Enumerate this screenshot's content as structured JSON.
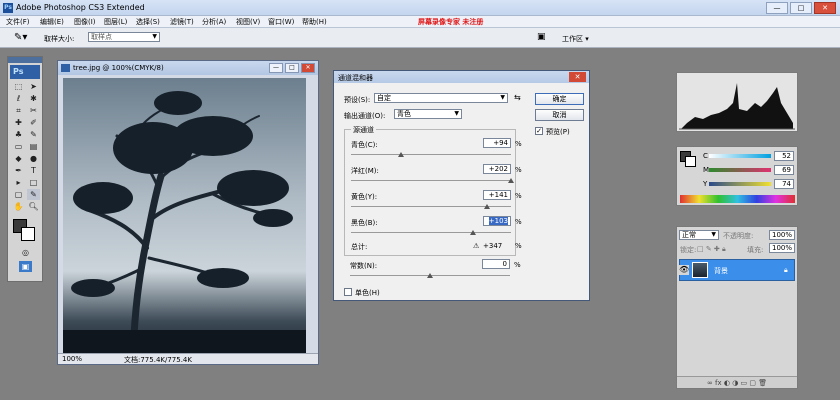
{
  "app": {
    "title": "Adobe Photoshop CS3 Extended",
    "watermark": "屏幕录像专家 未注册",
    "menu": [
      "文件(F)",
      "编辑(E)",
      "图像(I)",
      "图层(L)",
      "选择(S)",
      "滤镜(T)",
      "分析(A)",
      "视图(V)",
      "窗口(W)",
      "帮助(H)"
    ],
    "window_buttons": [
      "—",
      "□",
      "✕"
    ]
  },
  "options_bar": {
    "sample_size_label": "取样大小:",
    "sample_size_value": "取样点",
    "workspace_label": "工作区 ▾"
  },
  "document": {
    "title": "tree.jpg @ 100%(CMYK/8)",
    "zoom": "100%",
    "status": "文档:775.4K/775.4K"
  },
  "dialog": {
    "title": "通道混和器",
    "preset_label": "预设(S):",
    "preset_value": "自定",
    "output_label": "输出通道(O):",
    "output_value": "青色",
    "source_group_label": "源通道",
    "channels": [
      {
        "name": "青色(C):",
        "value": "+94",
        "unit": "%",
        "pct": 0.31,
        "highlight": false
      },
      {
        "name": "洋红(M):",
        "value": "+202",
        "unit": "%",
        "pct": 1.0,
        "highlight": false
      },
      {
        "name": "黄色(Y):",
        "value": "+141",
        "unit": "%",
        "pct": 0.85,
        "highlight": false
      },
      {
        "name": "黑色(B):",
        "value": "+103",
        "unit": "%",
        "pct": 0.76,
        "highlight": true
      }
    ],
    "total_label": "总计:",
    "total_value": "+347",
    "total_unit": "%",
    "constant_label": "常数(N):",
    "constant_value": "0",
    "constant_unit": "%",
    "constant_pct": 0.5,
    "mono_label": "单色(H)",
    "ok_label": "确定",
    "cancel_label": "取消",
    "preview_label": "预览(P)"
  },
  "color_panel": {
    "labels": [
      "C",
      "M",
      "Y"
    ],
    "values": [
      "52",
      "69",
      "74"
    ]
  },
  "layers_panel": {
    "blend_mode": "正常",
    "opacity_label": "不透明度:",
    "opacity_value": "100%",
    "lock_label": "锁定:",
    "fill_label": "填充:",
    "fill_value": "100%",
    "layer_name": "背景"
  },
  "colors": {
    "accent": "#3b8ee9",
    "title_blue": "#c3d5ee",
    "watermark_red": "#e01818"
  }
}
